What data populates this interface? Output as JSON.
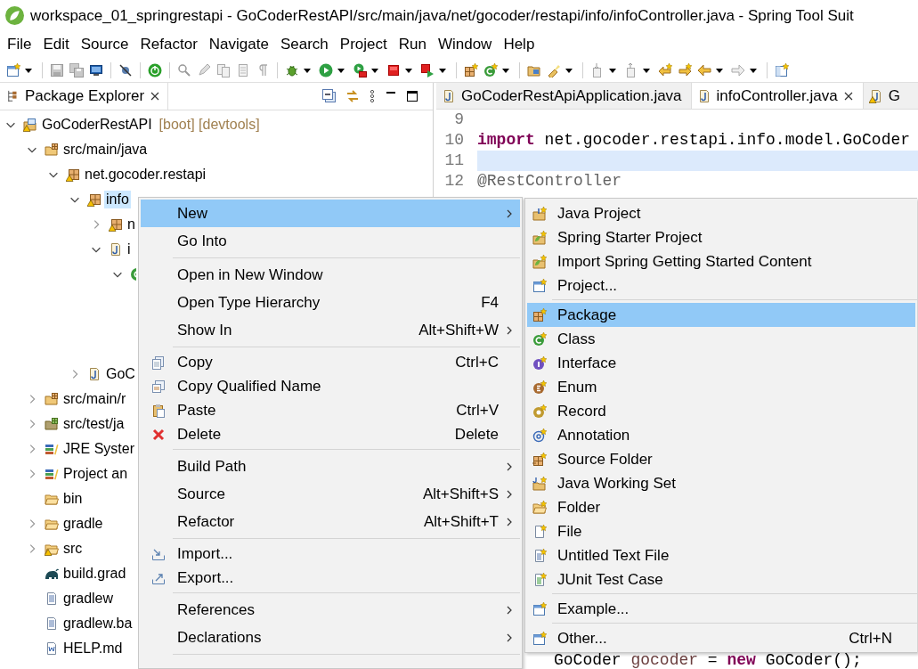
{
  "window": {
    "title": "workspace_01_springrestapi - GoCoderRestAPI/src/main/java/net/gocoder/restapi/info/infoController.java - Spring Tool Suit"
  },
  "menu_bar": [
    {
      "label": "File"
    },
    {
      "label": "Edit"
    },
    {
      "label": "Source"
    },
    {
      "label": "Refactor"
    },
    {
      "label": "Navigate"
    },
    {
      "label": "Search"
    },
    {
      "label": "Project"
    },
    {
      "label": "Run"
    },
    {
      "label": "Window"
    },
    {
      "label": "Help"
    }
  ],
  "package_explorer": {
    "tab": {
      "label": "Package Explorer",
      "selected": true
    },
    "tree": [
      {
        "label": "GoCoderRestAPI",
        "decoration": "[boot] [devtools]",
        "kind": "project",
        "warning": true,
        "expanded": true,
        "selected": false,
        "children": [
          {
            "label": "src/main/java",
            "kind": "source-folder",
            "warning": false,
            "expanded": true,
            "selected": false,
            "children": [
              {
                "label": "net.gocoder.restapi",
                "kind": "package",
                "warning": true,
                "expanded": true,
                "selected": false,
                "children": [
                  {
                    "label": "info",
                    "kind": "package",
                    "warning": true,
                    "expanded": true,
                    "selected": true,
                    "children": [
                      {
                        "label": "n",
                        "kind": "package",
                        "warning": true,
                        "expanded": false,
                        "selected": false
                      },
                      {
                        "label": "i",
                        "kind": "java",
                        "warning": false,
                        "expanded": true,
                        "selected": false,
                        "children": [
                          {
                            "kind": "class",
                            "warning": false,
                            "expanded": true,
                            "selected": false
                          }
                        ]
                      }
                    ]
                  },
                  {
                    "label": "GoC",
                    "kind": "java",
                    "warning": false,
                    "expanded": false,
                    "selected": false
                  }
                ]
              }
            ]
          },
          {
            "label": "src/main/r",
            "kind": "source-folder",
            "warning": false,
            "expanded": false,
            "selected": false
          },
          {
            "label": "src/test/ja",
            "kind": "test-folder",
            "warning": false,
            "expanded": false,
            "selected": false
          },
          {
            "label": "JRE Syster",
            "kind": "library",
            "warning": false,
            "expanded": false,
            "selected": false
          },
          {
            "label": "Project an",
            "kind": "library",
            "warning": false,
            "expanded": false,
            "selected": false
          },
          {
            "label": "bin",
            "kind": "folder",
            "warning": false,
            "selected": false
          },
          {
            "label": "gradle",
            "kind": "folder",
            "warning": false,
            "expanded": false,
            "selected": false
          },
          {
            "label": "src",
            "kind": "folder",
            "warning": true,
            "expanded": false,
            "selected": false
          },
          {
            "label": "build.grad",
            "kind": "gradle",
            "warning": false,
            "selected": false
          },
          {
            "label": "gradlew",
            "kind": "file",
            "warning": false,
            "selected": false
          },
          {
            "label": "gradlew.ba",
            "kind": "file",
            "warning": false,
            "selected": false
          },
          {
            "label": "HELP.md",
            "kind": "doc",
            "warning": false,
            "selected": false
          }
        ]
      }
    ]
  },
  "editor": {
    "tabs": [
      {
        "label": "GoCoderRestApiApplication.java",
        "selected": false,
        "warning": false
      },
      {
        "label": "infoController.java",
        "selected": true,
        "warning": false
      },
      {
        "label": "G",
        "selected": false,
        "warning": true
      }
    ],
    "lines": [
      {
        "number": "9",
        "current": false
      },
      {
        "number": "10",
        "current": false,
        "tokens": [
          {
            "kind": "keyword",
            "text": "import"
          },
          {
            "kind": "plain",
            "text": " net.gocoder.restapi.info.model.GoCoder"
          }
        ]
      },
      {
        "number": "11",
        "current": true
      },
      {
        "number": "12",
        "current": false,
        "tokens": [
          {
            "kind": "annotation",
            "text": "@RestController"
          }
        ]
      }
    ],
    "tail_line": {
      "tokens": [
        {
          "kind": "plain",
          "text": "GoCoder "
        },
        {
          "kind": "variable",
          "text": "gocoder"
        },
        {
          "kind": "plain",
          "text": " = "
        },
        {
          "kind": "keyword",
          "text": "new"
        },
        {
          "kind": "plain",
          "text": " GoCoder();"
        }
      ]
    }
  },
  "context_menu": {
    "items": [
      {
        "kind": "plain",
        "label": "New",
        "submenu": true,
        "selected": true
      },
      {
        "kind": "plain",
        "label": "Go Into",
        "submenu": false,
        "selected": false
      },
      {
        "kind": "separator"
      },
      {
        "kind": "plain",
        "label": "Open in New Window",
        "submenu": false,
        "selected": false
      },
      {
        "kind": "plain",
        "label": "Open Type Hierarchy",
        "shortcut": "F4",
        "submenu": false,
        "selected": false
      },
      {
        "kind": "plain",
        "label": "Show In",
        "shortcut": "Alt+Shift+W",
        "submenu": true,
        "selected": false
      },
      {
        "kind": "separator"
      },
      {
        "kind": "copy",
        "label": "Copy",
        "shortcut": "Ctrl+C",
        "submenu": false,
        "selected": false
      },
      {
        "kind": "copy-name",
        "label": "Copy Qualified Name",
        "submenu": false,
        "selected": false
      },
      {
        "kind": "paste",
        "label": "Paste",
        "shortcut": "Ctrl+V",
        "submenu": false,
        "selected": false
      },
      {
        "kind": "delete",
        "label": "Delete",
        "shortcut": "Delete",
        "submenu": false,
        "selected": false
      },
      {
        "kind": "separator"
      },
      {
        "kind": "plain",
        "label": "Build Path",
        "submenu": true,
        "selected": false
      },
      {
        "kind": "plain",
        "label": "Source",
        "shortcut": "Alt+Shift+S",
        "submenu": true,
        "selected": false
      },
      {
        "kind": "plain",
        "label": "Refactor",
        "shortcut": "Alt+Shift+T",
        "submenu": true,
        "selected": false
      },
      {
        "kind": "separator"
      },
      {
        "kind": "import",
        "label": "Import...",
        "submenu": false,
        "selected": false
      },
      {
        "kind": "export",
        "label": "Export...",
        "submenu": false,
        "selected": false
      },
      {
        "kind": "separator"
      },
      {
        "kind": "plain",
        "label": "References",
        "submenu": true,
        "selected": false
      },
      {
        "kind": "plain",
        "label": "Declarations",
        "submenu": true,
        "selected": false
      },
      {
        "kind": "separator"
      }
    ]
  },
  "new_submenu": {
    "items": [
      {
        "kind": "java-project",
        "label": "Java Project",
        "selected": false
      },
      {
        "kind": "spring-project",
        "label": "Spring Starter Project",
        "selected": false
      },
      {
        "kind": "spring-project",
        "label": "Import Spring Getting Started Content",
        "selected": false
      },
      {
        "kind": "new-window",
        "label": "Project...",
        "selected": false
      },
      {
        "kind": "separator"
      },
      {
        "kind": "package",
        "label": "Package",
        "selected": true
      },
      {
        "kind": "class",
        "label": "Class",
        "selected": false
      },
      {
        "kind": "interface",
        "label": "Interface",
        "selected": false
      },
      {
        "kind": "enum",
        "label": "Enum",
        "selected": false
      },
      {
        "kind": "record",
        "label": "Record",
        "selected": false
      },
      {
        "kind": "annotation",
        "label": "Annotation",
        "selected": false
      },
      {
        "kind": "source-folder",
        "label": "Source Folder",
        "selected": false
      },
      {
        "kind": "working-set",
        "label": "Java Working Set",
        "selected": false
      },
      {
        "kind": "folder",
        "label": "Folder",
        "selected": false
      },
      {
        "kind": "file",
        "label": "File",
        "selected": false
      },
      {
        "kind": "text-file",
        "label": "Untitled Text File",
        "selected": false
      },
      {
        "kind": "junit",
        "label": "JUnit Test Case",
        "selected": false
      },
      {
        "kind": "separator"
      },
      {
        "kind": "new-window",
        "label": "Example...",
        "selected": false
      },
      {
        "kind": "separator"
      },
      {
        "kind": "new-window",
        "label": "Other...",
        "shortcut": "Ctrl+N",
        "selected": false
      }
    ]
  }
}
